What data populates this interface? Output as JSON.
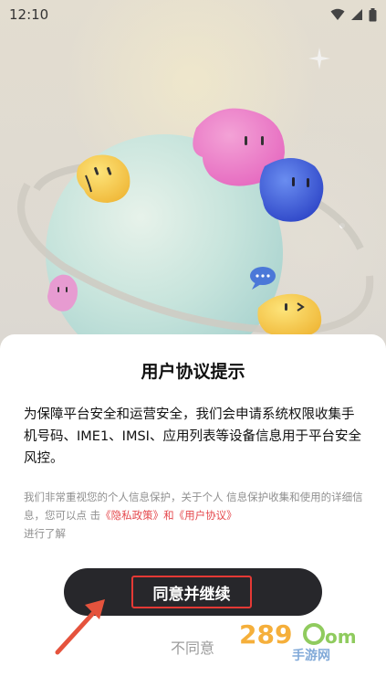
{
  "status_bar": {
    "time": "12:10",
    "icons": [
      "wifi-icon",
      "signal-icon",
      "battery-icon"
    ]
  },
  "dialog": {
    "title": "用户协议提示",
    "body": "为保障平台安全和运营安全，我们会申请系统权限收集手机号码、IME1、IMSI、应用列表等设备信息用于平台安全风控。",
    "note_prefix": "我们非常重视您的个人信息保护，关于个人 信息保护收集和使用的详细信息，您可以点 击",
    "privacy_link": "《隐私政策》",
    "and_text": "和",
    "user_agreement_link": "《用户协议》",
    "note_suffix": "进行了解",
    "agree_label": "同意并继续",
    "disagree_label": "不同意"
  },
  "watermark": {
    "brand": "289.com",
    "subtitle": "手游网"
  },
  "colors": {
    "accent_link": "#e5484d",
    "button_bg": "#27272b",
    "highlight_border": "#e53935",
    "arrow": "#e5533d"
  }
}
